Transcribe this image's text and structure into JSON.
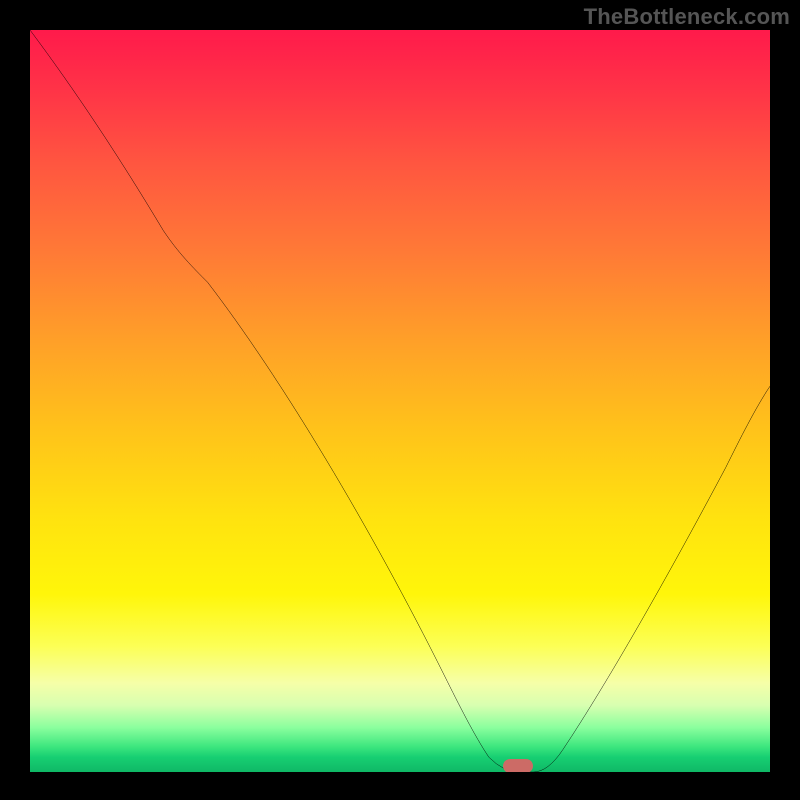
{
  "watermark": "TheBottleneck.com",
  "colors": {
    "frame_bg": "#000000",
    "curve_stroke": "#000000",
    "marker_fill": "#cc6b66",
    "watermark_text": "#555555"
  },
  "chart_data": {
    "type": "line",
    "title": "",
    "xlabel": "",
    "ylabel": "",
    "x_range": [
      0,
      100
    ],
    "y_range": [
      0,
      100
    ],
    "x": [
      0,
      5,
      10,
      15,
      20,
      25,
      30,
      35,
      40,
      45,
      50,
      55,
      58,
      60,
      63,
      65,
      67,
      70,
      75,
      80,
      85,
      90,
      95,
      100
    ],
    "values": [
      100,
      93,
      86,
      78,
      72,
      67,
      59,
      50,
      41,
      32,
      23,
      14,
      7,
      3,
      1,
      0,
      0,
      1,
      7,
      15,
      24,
      32,
      41,
      52
    ],
    "marker": {
      "x": 66,
      "y": 0
    },
    "notes": "V-shaped bottleneck curve on red→green vertical gradient. Min near x≈65–67; left descent steeper with slight knee around x≈15–20; right ascent roughly linear to y≈52 at x=100. No axis ticks or labels visible."
  }
}
